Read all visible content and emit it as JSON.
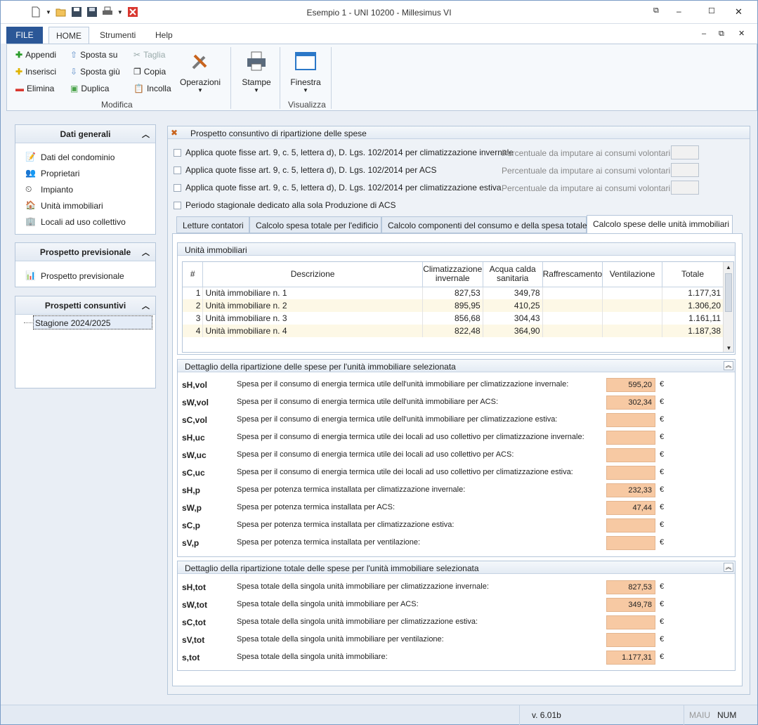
{
  "window": {
    "title": "Esempio 1 - UNI 10200 - Millesimus VI"
  },
  "menu": {
    "file": "FILE",
    "home": "HOME",
    "strumenti": "Strumenti",
    "help": "Help"
  },
  "ribbon": {
    "appendi": "Appendi",
    "inserisci": "Inserisci",
    "elimina": "Elimina",
    "sposta_su": "Sposta su",
    "sposta_giu": "Sposta giù",
    "duplica": "Duplica",
    "taglia": "Taglia",
    "copia": "Copia",
    "incolla": "Incolla",
    "operazioni": "Operazioni",
    "stampe": "Stampe",
    "finestra": "Finestra",
    "group_modifica": "Modifica",
    "group_visualizza": "Visualizza"
  },
  "sidebar": {
    "dati_generali": {
      "title": "Dati generali",
      "items": [
        "Dati del condominio",
        "Proprietari",
        "Impianto",
        "Unità immobiliari",
        "Locali ad uso collettivo"
      ]
    },
    "previsionale": {
      "title": "Prospetto previsionale",
      "items": [
        "Prospetto previsionale"
      ]
    },
    "consuntivi": {
      "title": "Prospetti consuntivi",
      "items": [
        "Stagione 2024/2025"
      ]
    }
  },
  "main": {
    "title": "Prospetto consuntivo di ripartizione delle spese",
    "checks": [
      "Applica quote fisse art. 9, c. 5, lettera d), D. Lgs. 102/2014 per climatizzazione invernale",
      "Applica quote fisse art. 9, c. 5, lettera d), D. Lgs. 102/2014 per ACS",
      "Applica quote fisse art. 9, c. 5, lettera d), D. Lgs. 102/2014 per climatizzazione estiva",
      "Periodo stagionale dedicato alla sola Produzione di ACS"
    ],
    "perc_label": "Percentuale da imputare ai consumi volontari:",
    "tabs": [
      "Letture contatori",
      "Calcolo spesa totale per l'edificio",
      "Calcolo componenti del consumo e della spesa totale",
      "Calcolo spese delle unità immobiliari"
    ]
  },
  "units": {
    "title": "Unità immobiliari",
    "headers": [
      "#",
      "Descrizione",
      "Climatizzazione invernale",
      "Acqua calda sanitaria",
      "Raffrescamento",
      "Ventilazione",
      "Totale"
    ],
    "rows": [
      [
        "1",
        "Unità immobiliare n. 1",
        "827,53",
        "349,78",
        "",
        "",
        "1.177,31"
      ],
      [
        "2",
        "Unità immobiliare n. 2",
        "895,95",
        "410,25",
        "",
        "",
        "1.306,20"
      ],
      [
        "3",
        "Unità immobiliare n. 3",
        "856,68",
        "304,43",
        "",
        "",
        "1.161,11"
      ],
      [
        "4",
        "Unità immobiliare n. 4",
        "822,48",
        "364,90",
        "",
        "",
        "1.187,38"
      ]
    ]
  },
  "detail": {
    "title": "Dettaglio della ripartizione delle spese per l'unità immobiliare selezionata",
    "rows": [
      {
        "code": "sH,vol",
        "desc": "Spesa per il consumo di energia termica utile dell'unità immobiliare per climatizzazione invernale:",
        "value": "595,20"
      },
      {
        "code": "sW,vol",
        "desc": "Spesa per il consumo di energia termica utile dell'unità immobiliare per ACS:",
        "value": "302,34"
      },
      {
        "code": "sC,vol",
        "desc": "Spesa per il consumo di energia termica utile dell'unità immobiliare per climatizzazione estiva:",
        "value": ""
      },
      {
        "code": "sH,uc",
        "desc": "Spesa per il consumo di energia termica utile dei locali ad uso collettivo per climatizzazione invernale:",
        "value": ""
      },
      {
        "code": "sW,uc",
        "desc": "Spesa per il consumo di energia termica utile dei locali ad uso collettivo per ACS:",
        "value": ""
      },
      {
        "code": "sC,uc",
        "desc": "Spesa per il consumo di energia termica utile dei locali ad uso collettivo per climatizzazione estiva:",
        "value": ""
      },
      {
        "code": "sH,p",
        "desc": "Spesa per potenza termica installata per climatizzazione invernale:",
        "value": "232,33"
      },
      {
        "code": "sW,p",
        "desc": "Spesa per potenza termica installata per ACS:",
        "value": "47,44"
      },
      {
        "code": "sC,p",
        "desc": "Spesa per potenza termica installata per climatizzazione estiva:",
        "value": ""
      },
      {
        "code": "sV,p",
        "desc": "Spesa per potenza termica installata per ventilazione:",
        "value": ""
      }
    ]
  },
  "total": {
    "title": "Dettaglio della ripartizione totale delle spese per l'unità immobiliare selezionata",
    "rows": [
      {
        "code": "sH,tot",
        "desc": "Spesa totale della singola unità immobiliare per climatizzazione invernale:",
        "value": "827,53"
      },
      {
        "code": "sW,tot",
        "desc": "Spesa totale della singola unità immobiliare per ACS:",
        "value": "349,78"
      },
      {
        "code": "sC,tot",
        "desc": "Spesa totale della singola unità immobiliare per climatizzazione estiva:",
        "value": ""
      },
      {
        "code": "sV,tot",
        "desc": "Spesa totale della singola unità immobiliare per ventilazione:",
        "value": ""
      },
      {
        "code": "s,tot",
        "desc": "Spesa totale della singola unità immobiliare:",
        "value": "1.177,31"
      }
    ]
  },
  "currency": "€",
  "status": {
    "version": "v. 6.01b",
    "maiu": "MAIU",
    "num": "NUM"
  },
  "colors": {
    "accent": "#2b5797",
    "value_bg": "#f7c9a3"
  }
}
